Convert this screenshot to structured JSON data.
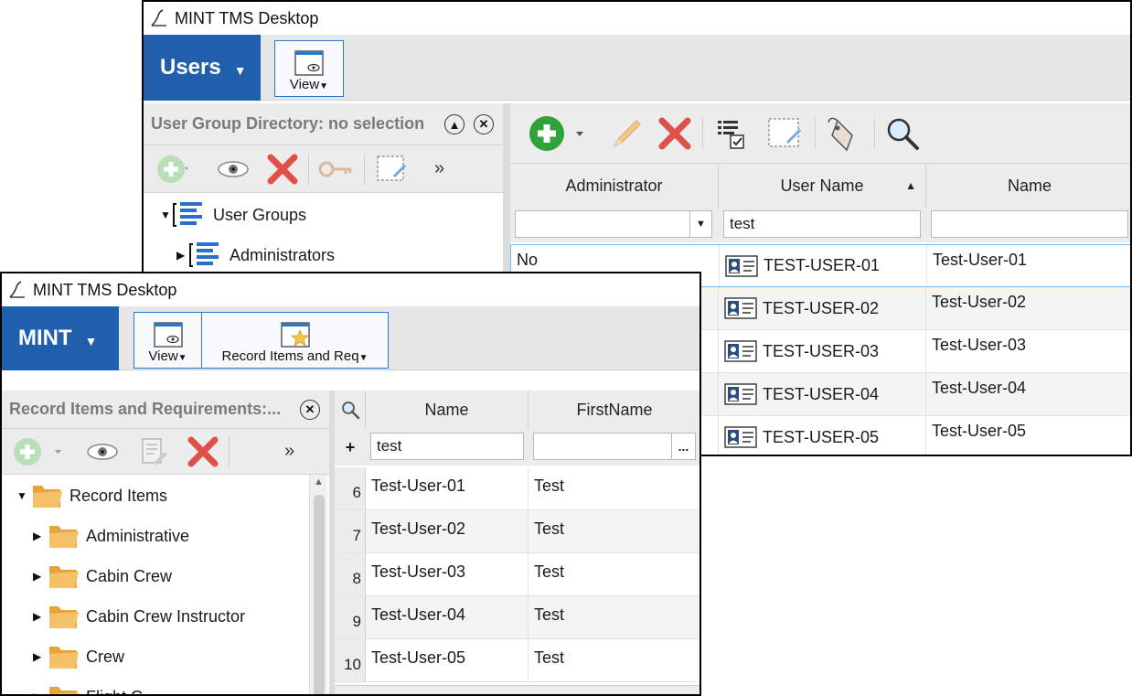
{
  "users_window": {
    "title": "MINT TMS Desktop",
    "app_button": "Users",
    "ribbon": {
      "view_label": "View"
    },
    "left_panel": {
      "header": "User Group Directory: no selection",
      "more": "»",
      "tree": [
        {
          "label": "User Groups"
        },
        {
          "label": "Administrators"
        }
      ]
    },
    "grid": {
      "columns": [
        "Administrator",
        "User Name",
        "Name"
      ],
      "filters": {
        "administrator": "",
        "user_name": "test",
        "name": ""
      },
      "rows": [
        {
          "administrator": "No",
          "user_name": "TEST-USER-01",
          "name": "Test-User-01"
        },
        {
          "administrator": "",
          "user_name": "TEST-USER-02",
          "name": "Test-User-02"
        },
        {
          "administrator": "",
          "user_name": "TEST-USER-03",
          "name": "Test-User-03"
        },
        {
          "administrator": "",
          "user_name": "TEST-USER-04",
          "name": "Test-User-04"
        },
        {
          "administrator": "",
          "user_name": "TEST-USER-05",
          "name": "Test-User-05"
        }
      ]
    }
  },
  "mint_window": {
    "title": "MINT TMS Desktop",
    "app_button": "MINT",
    "ribbon": {
      "view_label": "View",
      "record_label": "Record Items and Req"
    },
    "left_panel": {
      "header": "Record Items and Requirements:...",
      "more": "»",
      "tree": [
        {
          "label": "Record Items"
        },
        {
          "label": "Administrative"
        },
        {
          "label": "Cabin Crew"
        },
        {
          "label": "Cabin Crew Instructor"
        },
        {
          "label": "Crew"
        },
        {
          "label": "Flight C..."
        }
      ]
    },
    "grid": {
      "columns": [
        "Name",
        "FirstName"
      ],
      "filters": {
        "name": "test",
        "first_name": "",
        "add": "+",
        "ellipsis": "..."
      },
      "rows": [
        {
          "num": "6",
          "name": "Test-User-01",
          "first_name": "Test"
        },
        {
          "num": "7",
          "name": "Test-User-02",
          "first_name": "Test"
        },
        {
          "num": "8",
          "name": "Test-User-03",
          "first_name": "Test"
        },
        {
          "num": "9",
          "name": "Test-User-04",
          "first_name": "Test"
        },
        {
          "num": "10",
          "name": "Test-User-05",
          "first_name": "Test"
        }
      ]
    }
  },
  "colors": {
    "app_blue": "#1f5fae",
    "add_green": "#2fa33a",
    "delete_red": "#e0504a",
    "tree_blue": "#2a6fc9",
    "folder_orange": "#e6a43a"
  }
}
